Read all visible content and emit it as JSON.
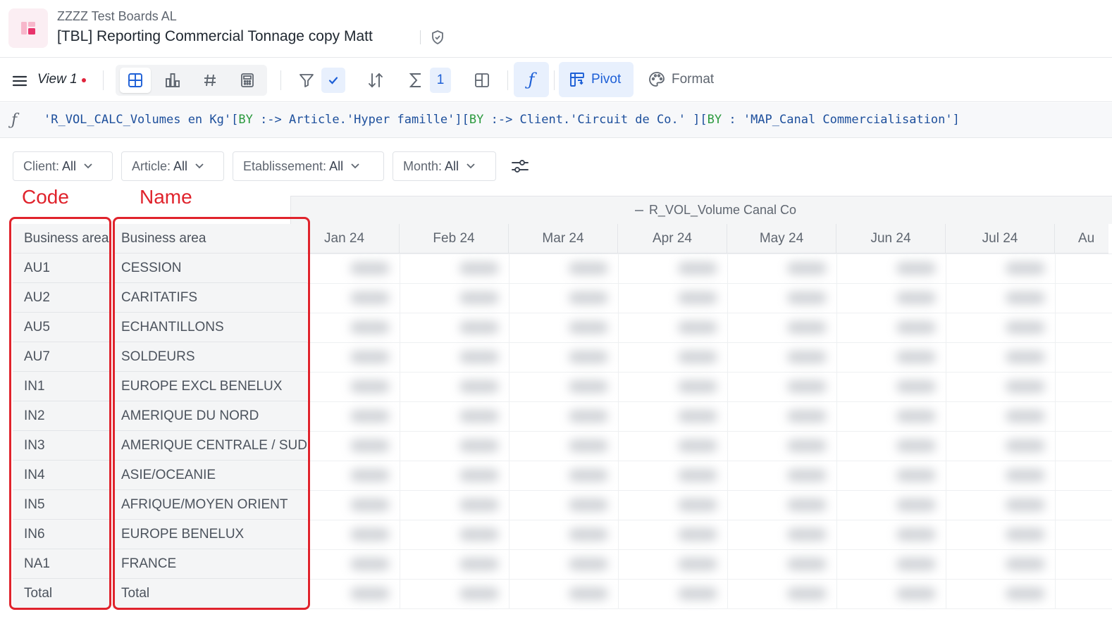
{
  "header": {
    "workspace": "ZZZZ Test Boards AL",
    "title": "[TBL] Reporting Commercial Tonnage copy Matt"
  },
  "toolbar": {
    "view_label": "View 1",
    "sum_count": "1",
    "pivot_label": "Pivot",
    "format_label": "Format"
  },
  "formula": {
    "part1": "'R_VOL_CALC_Volumes en Kg'[",
    "kw1": "BY",
    "part2": " :-> Article.'Hyper famille'][",
    "kw2": "BY",
    "part3": " :-> Client.'Circuit de Co.' ][",
    "kw3": "BY",
    "part4": " : 'MAP_Canal Commercialisation']"
  },
  "filters": [
    {
      "name": "Client:",
      "value": "All"
    },
    {
      "name": "Article:",
      "value": "All"
    },
    {
      "name": "Etablissement:",
      "value": "All"
    },
    {
      "name": "Month:",
      "value": "All"
    }
  ],
  "annotations": {
    "code": "Code",
    "name": "Name"
  },
  "table": {
    "measure": "R_VOL_Volume Canal Co",
    "months": [
      "Jan 24",
      "Feb 24",
      "Mar 24",
      "Apr 24",
      "May 24",
      "Jun 24",
      "Jul 24",
      "Au"
    ],
    "code_header": "Business area",
    "name_header": "Business area",
    "rows": [
      {
        "code": "AU1",
        "name": "CESSION"
      },
      {
        "code": "AU2",
        "name": "CARITATIFS"
      },
      {
        "code": "AU5",
        "name": "ECHANTILLONS"
      },
      {
        "code": "AU7",
        "name": "SOLDEURS"
      },
      {
        "code": "IN1",
        "name": "EUROPE EXCL BENELUX"
      },
      {
        "code": "IN2",
        "name": "AMERIQUE DU NORD"
      },
      {
        "code": "IN3",
        "name": "AMERIQUE CENTRALE / SUD"
      },
      {
        "code": "IN4",
        "name": "ASIE/OCEANIE"
      },
      {
        "code": "IN5",
        "name": "AFRIQUE/MOYEN ORIENT"
      },
      {
        "code": "IN6",
        "name": "EUROPE BENELUX"
      },
      {
        "code": "NA1",
        "name": "FRANCE"
      },
      {
        "code": "Total",
        "name": "Total"
      }
    ]
  },
  "colors": {
    "accent": "#1d5fd6",
    "annotation_red": "#e0232c",
    "header_bg": "#f4f5f6"
  }
}
